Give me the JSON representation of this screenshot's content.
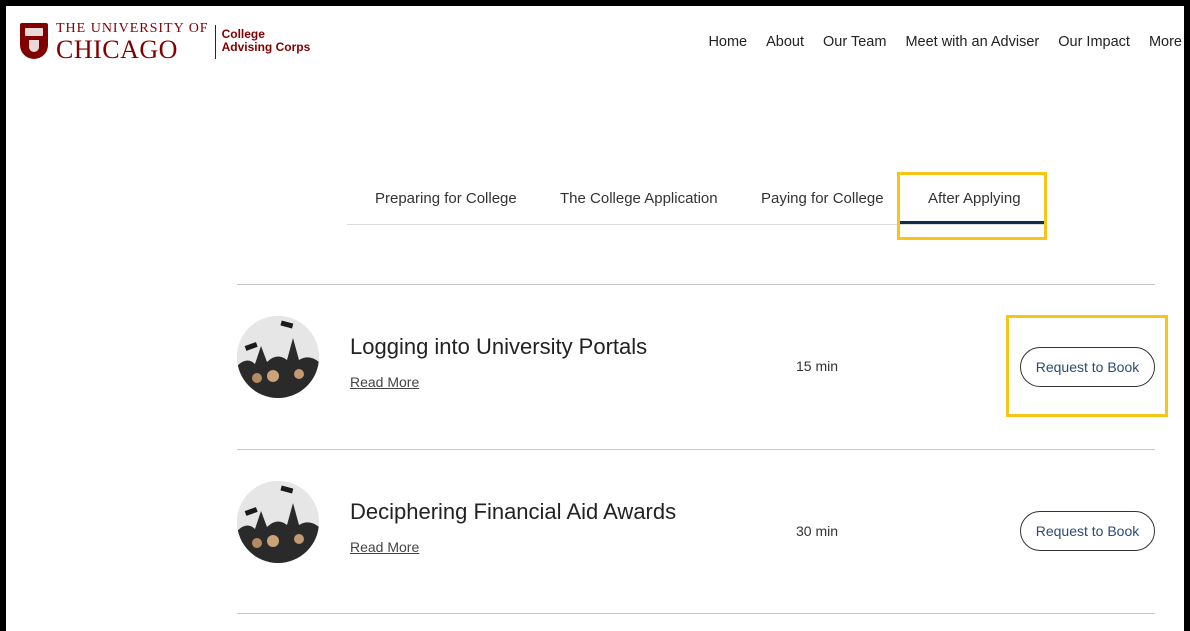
{
  "logo": {
    "line1": "THE UNIVERSITY OF",
    "line2": "CHICAGO",
    "corps1": "College",
    "corps2": "Advising Corps"
  },
  "nav": [
    "Home",
    "About",
    "Our Team",
    "Meet with an Adviser",
    "Our Impact",
    "More"
  ],
  "tabs": [
    "Preparing for College",
    "The College Application",
    "Paying for College",
    "After Applying"
  ],
  "services": [
    {
      "title": "Logging into University Portals",
      "link": "Read More",
      "duration": "15 min",
      "button": "Request to Book"
    },
    {
      "title": "Deciphering Financial Aid Awards",
      "link": "Read More",
      "duration": "30 min",
      "button": "Request to Book"
    }
  ],
  "colors": {
    "maroon": "#800000",
    "accent": "#0f2d4f",
    "highlight": "#f5c518",
    "button_text": "#2b4a75"
  }
}
